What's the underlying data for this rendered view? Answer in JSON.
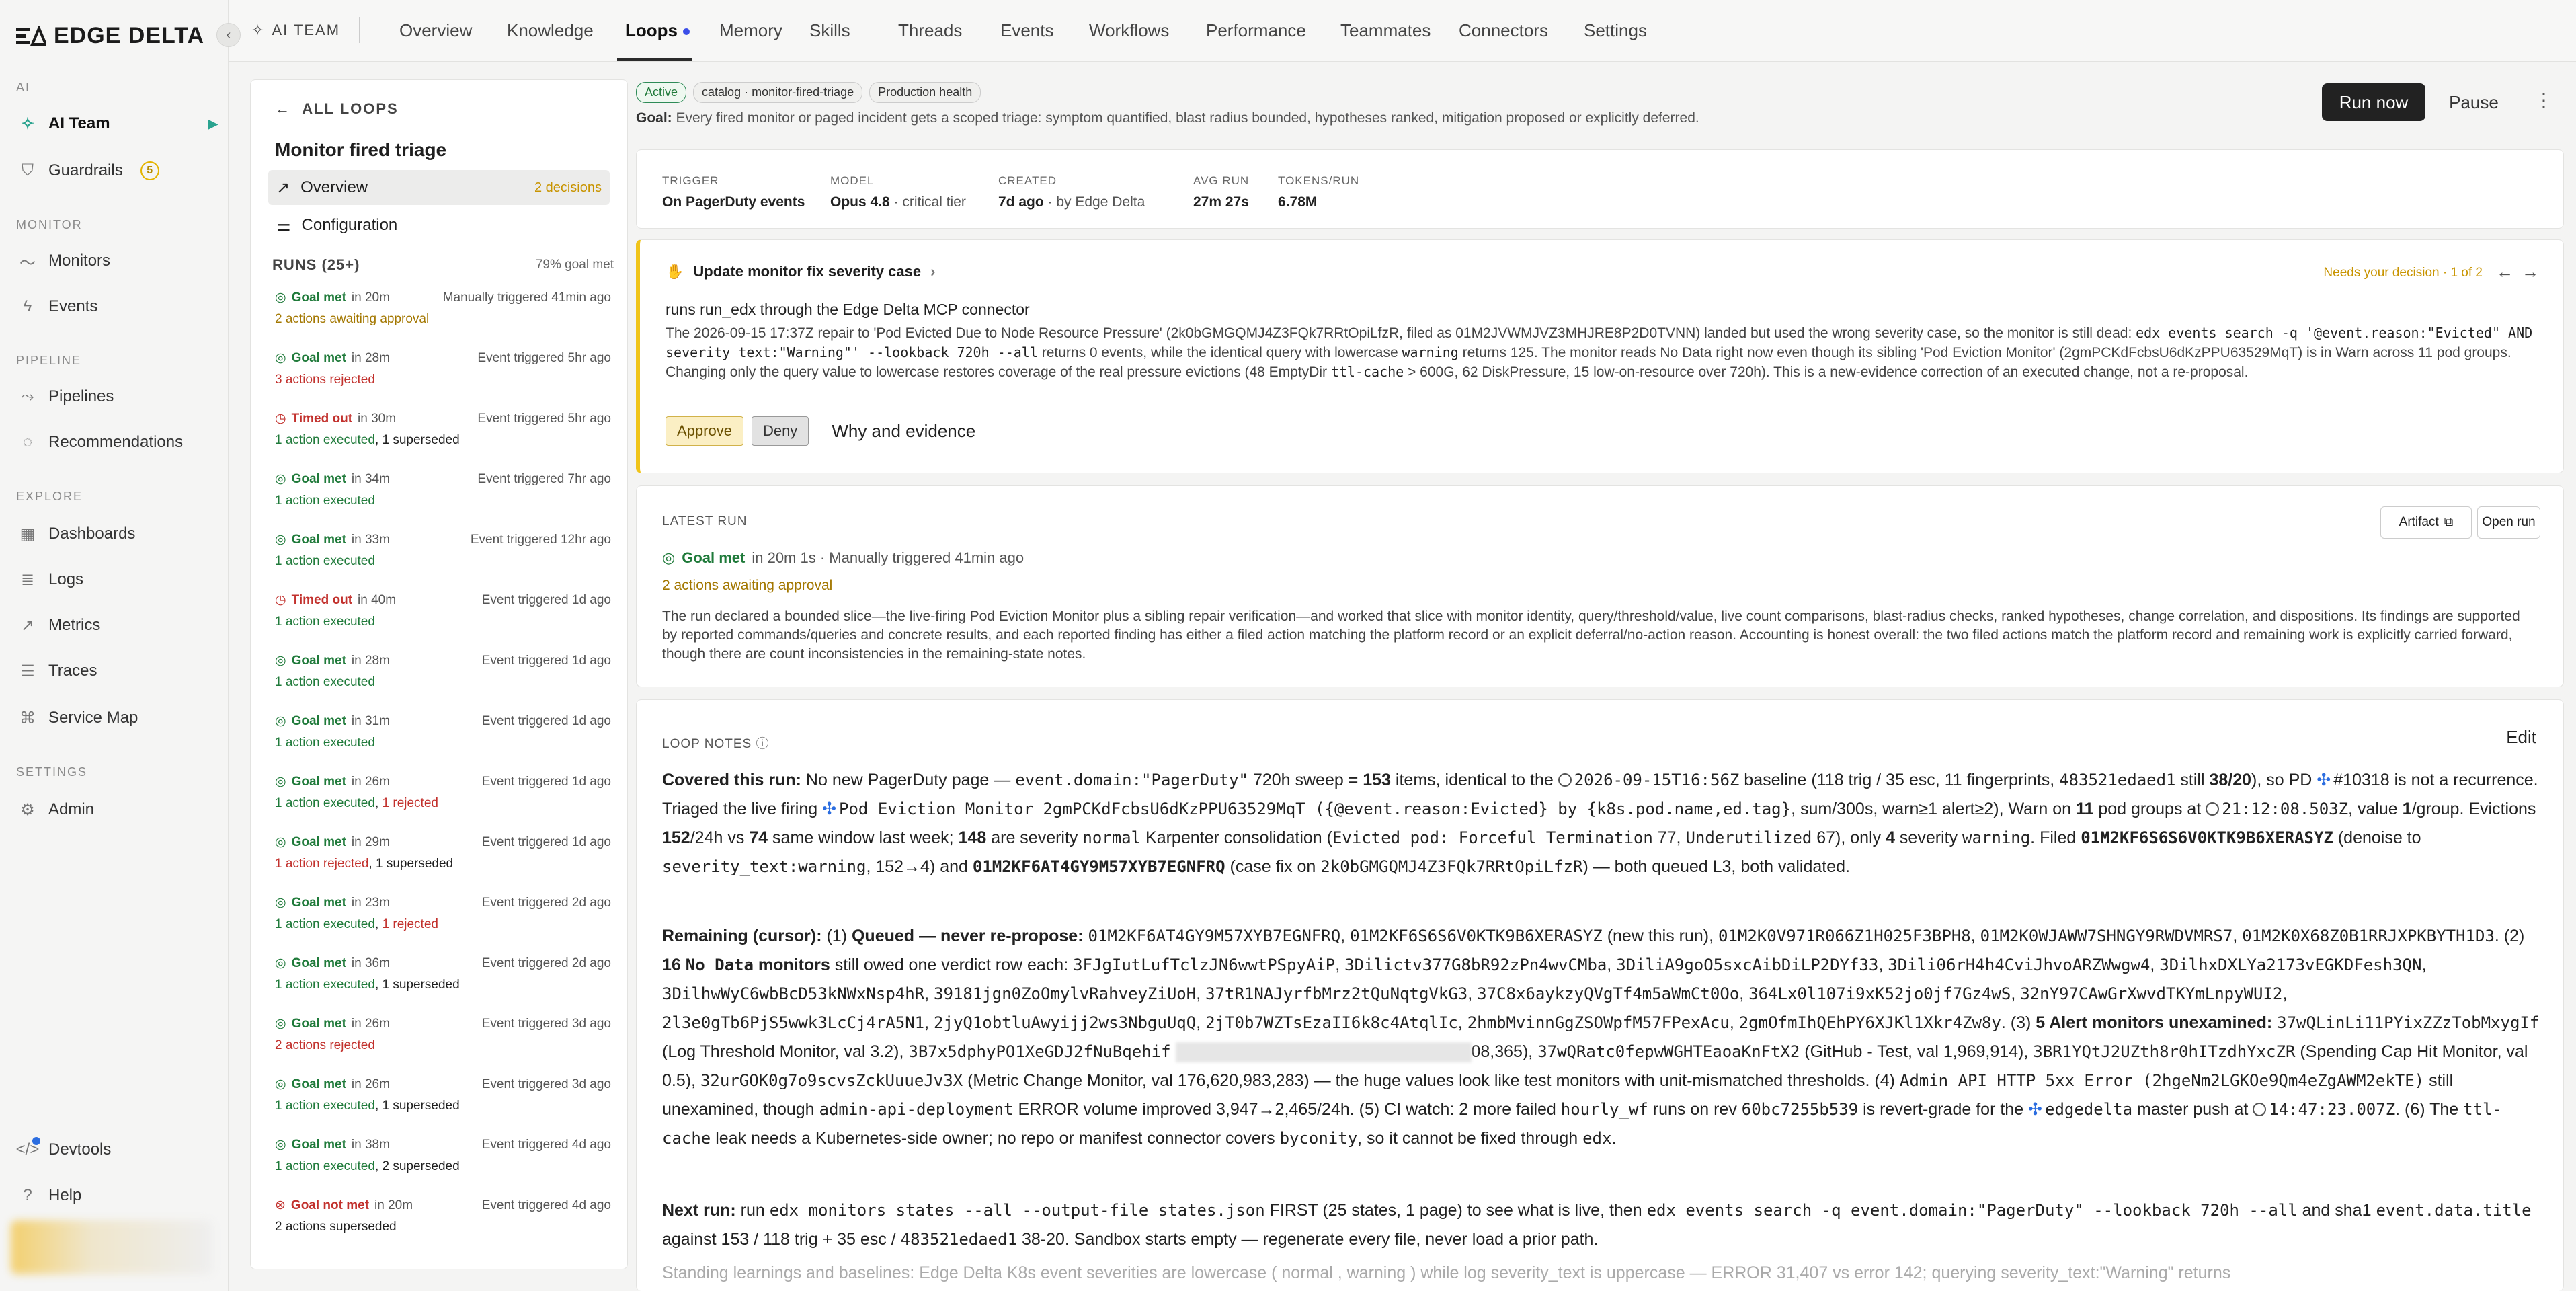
{
  "brand": {
    "name": "EDGE DELTA"
  },
  "leftnav": {
    "sections": {
      "ai": "AI",
      "monitor": "MONITOR",
      "pipeline": "PIPELINE",
      "explore": "EXPLORE",
      "settings": "SETTINGS"
    },
    "items": {
      "ai_team": "AI Team",
      "guardrails": "Guardrails",
      "guardrails_count": "5",
      "monitors": "Monitors",
      "events": "Events",
      "pipelines": "Pipelines",
      "recommendations": "Recommendations",
      "dashboards": "Dashboards",
      "logs": "Logs",
      "metrics": "Metrics",
      "traces": "Traces",
      "service_map": "Service Map",
      "admin": "Admin",
      "devtools": "Devtools",
      "help": "Help"
    }
  },
  "topbar": {
    "crumb": "AI TEAM",
    "tabs": [
      "Overview",
      "Knowledge",
      "Loops",
      "Memory",
      "Skills",
      "Threads",
      "Events",
      "Workflows",
      "Performance",
      "Teammates",
      "Connectors",
      "Settings"
    ],
    "active_tab": "Loops"
  },
  "loop": {
    "back": "ALL LOOPS",
    "title": "Monitor fired triage",
    "overview": "Overview",
    "decisions": "2 decisions",
    "configuration": "Configuration",
    "runs_header": "RUNS (25+)",
    "runs_meta": "79% goal met",
    "runs": [
      {
        "status": "Goal met",
        "dur": "in 20m",
        "trigger": "Manually triggered 41min ago",
        "detail": [
          {
            "t": "2 actions awaiting approval",
            "c": "amber"
          }
        ]
      },
      {
        "status": "Goal met",
        "dur": "in 28m",
        "trigger": "Event triggered 5hr ago",
        "detail": [
          {
            "t": "3 actions rejected",
            "c": "red"
          }
        ]
      },
      {
        "status": "Timed out",
        "dur": "in 30m",
        "trigger": "Event triggered 5hr ago",
        "detail": [
          {
            "t": "1 action executed",
            "c": "green"
          },
          {
            "t": ", ",
            "c": ""
          },
          {
            "t": "1 superseded",
            "c": ""
          }
        ]
      },
      {
        "status": "Goal met",
        "dur": "in 34m",
        "trigger": "Event triggered 7hr ago",
        "detail": [
          {
            "t": "1 action executed",
            "c": "green"
          }
        ]
      },
      {
        "status": "Goal met",
        "dur": "in 33m",
        "trigger": "Event triggered 12hr ago",
        "detail": [
          {
            "t": "1 action executed",
            "c": "green"
          }
        ]
      },
      {
        "status": "Timed out",
        "dur": "in 40m",
        "trigger": "Event triggered 1d ago",
        "detail": [
          {
            "t": "1 action executed",
            "c": "green"
          }
        ]
      },
      {
        "status": "Goal met",
        "dur": "in 28m",
        "trigger": "Event triggered 1d ago",
        "detail": [
          {
            "t": "1 action executed",
            "c": "green"
          }
        ]
      },
      {
        "status": "Goal met",
        "dur": "in 31m",
        "trigger": "Event triggered 1d ago",
        "detail": [
          {
            "t": "1 action executed",
            "c": "green"
          }
        ]
      },
      {
        "status": "Goal met",
        "dur": "in 26m",
        "trigger": "Event triggered 1d ago",
        "detail": [
          {
            "t": "1 action executed",
            "c": "green"
          },
          {
            "t": ", ",
            "c": ""
          },
          {
            "t": "1 rejected",
            "c": "red"
          }
        ]
      },
      {
        "status": "Goal met",
        "dur": "in 29m",
        "trigger": "Event triggered 1d ago",
        "detail": [
          {
            "t": "1 action rejected",
            "c": "red"
          },
          {
            "t": ", ",
            "c": ""
          },
          {
            "t": "1 superseded",
            "c": ""
          }
        ]
      },
      {
        "status": "Goal met",
        "dur": "in 23m",
        "trigger": "Event triggered 2d ago",
        "detail": [
          {
            "t": "1 action executed",
            "c": "green"
          },
          {
            "t": ", ",
            "c": ""
          },
          {
            "t": "1 rejected",
            "c": "red"
          }
        ]
      },
      {
        "status": "Goal met",
        "dur": "in 36m",
        "trigger": "Event triggered 2d ago",
        "detail": [
          {
            "t": "1 action executed",
            "c": "green"
          },
          {
            "t": ", ",
            "c": ""
          },
          {
            "t": "1 superseded",
            "c": ""
          }
        ]
      },
      {
        "status": "Goal met",
        "dur": "in 26m",
        "trigger": "Event triggered 3d ago",
        "detail": [
          {
            "t": "2 actions rejected",
            "c": "red"
          }
        ]
      },
      {
        "status": "Goal met",
        "dur": "in 26m",
        "trigger": "Event triggered 3d ago",
        "detail": [
          {
            "t": "1 action executed",
            "c": "green"
          },
          {
            "t": ", ",
            "c": ""
          },
          {
            "t": "1 superseded",
            "c": ""
          }
        ]
      },
      {
        "status": "Goal met",
        "dur": "in 38m",
        "trigger": "Event triggered 4d ago",
        "detail": [
          {
            "t": "1 action executed",
            "c": "green"
          },
          {
            "t": ", ",
            "c": ""
          },
          {
            "t": "2 superseded",
            "c": ""
          }
        ]
      },
      {
        "status": "Goal not met",
        "dur": "in 20m",
        "trigger": "Event triggered 4d ago",
        "detail": [
          {
            "t": "2 actions superseded",
            "c": ""
          }
        ]
      }
    ]
  },
  "header": {
    "badges": [
      "Active",
      "catalog · monitor-fired-triage",
      "Production health"
    ],
    "goal_label": "Goal:",
    "goal": "Every fired monitor or paged incident gets a scoped triage: symptom quantified, blast radius bounded, hypotheses ranked, mitigation proposed or explicitly deferred.",
    "run_now": "Run now",
    "pause": "Pause"
  },
  "meta": {
    "trigger_k": "TRIGGER",
    "trigger_v": "On PagerDuty events",
    "model_k": "MODEL",
    "model_v": "Opus 4.8",
    "model_extra": " · critical tier",
    "created_k": "CREATED",
    "created_v": "7d ago",
    "created_extra": " · by Edge Delta",
    "avg_k": "AVG RUN",
    "avg_v": "27m 27s",
    "tokens_k": "TOKENS/RUN",
    "tokens_v": "6.78M"
  },
  "decision": {
    "title": "Update monitor fix severity case",
    "needs": "Needs your decision · 1 of 2",
    "sub": "runs run_edx through the Edge Delta MCP connector",
    "body1": "The 2026-09-15 17:37Z repair to 'Pod Evicted Due to Node Resource Pressure' (2k0bGMGQMJ4Z3FQk7RRtOpiLfzR, filed as 01M2JVWMJVZ3MHJRE8P2D0TVNN) landed but used the wrong severity case, so the monitor is still dead: ",
    "code1": "edx events search -q '@event.reason:\"Evicted\" AND severity_text:\"Warning\"' --lookback 720h --all",
    "body2": " returns 0 events, while the identical query with lowercase ",
    "code2": "warning",
    "body3": " returns 125. The monitor reads No Data right now even though its sibling 'Pod Eviction Monitor' (2gmPCKdFcbsU6dKzPPU63529MqT) is in Warn across 11 pod groups. Changing only the query value to lowercase restores coverage of the real pressure evictions (48 EmptyDir ",
    "code3": "ttl-cache",
    "body4": " > 600G, 62 DiskPressure, 15 low-on-resource over 720h). This is a new-evidence correction of an executed change, not a re-proposal.",
    "approve": "Approve",
    "deny": "Deny",
    "why": "Why and evidence"
  },
  "latest": {
    "label": "LATEST RUN",
    "artifact": "Artifact",
    "open_run": "Open run",
    "status": "Goal met",
    "detail": " in 20m 1s · Manually triggered 41min ago",
    "awaiting": "2 actions awaiting approval",
    "body": "The run declared a bounded slice—the live-firing Pod Eviction Monitor plus a sibling repair verification—and worked that slice with monitor identity, query/threshold/value, live count comparisons, blast-radius checks, ranked hypotheses, change correlation, and dispositions. Its findings are supported by reported commands/queries and concrete results, and each reported finding has either a filed action matching the platform record or an explicit deferral/no-action reason. Accounting is honest overall: the two filed actions match the platform record and remaining work is explicitly carried forward, though there are count inconsistencies in the remaining-state notes."
  },
  "notes": {
    "label": "LOOP NOTES",
    "edit": "Edit",
    "p1": [
      [
        "b",
        "Covered this run:"
      ],
      [
        "t",
        " No new PagerDuty page — "
      ],
      [
        "m",
        "event.domain:\"PagerDuty\""
      ],
      [
        "t",
        " 720h sweep = "
      ],
      [
        "b",
        "153"
      ],
      [
        "t",
        " items, identical to the "
      ],
      [
        "clock",
        ""
      ],
      [
        "m",
        "2026-09-15T16:56Z"
      ],
      [
        "t",
        " baseline (118 trig / 35 esc, 11 fingerprints, "
      ],
      [
        "m",
        "483521edaed1"
      ],
      [
        "t",
        " still "
      ],
      [
        "b",
        "38/20"
      ],
      [
        "t",
        "), so PD "
      ],
      [
        "fan",
        ""
      ],
      [
        "t",
        "#10318 is not a recurrence. Triaged the live firing "
      ],
      [
        "fan",
        ""
      ],
      [
        "m",
        "Pod Eviction Monitor 2gmPCKdFcbsU6dKzPPU63529MqT ({@event.reason:Evicted} by {k8s.pod.name,ed.tag}"
      ],
      [
        "t",
        ", sum/300s, warn≥1 alert≥2), Warn on "
      ],
      [
        "b",
        "11"
      ],
      [
        "t",
        " pod groups at "
      ],
      [
        "clock",
        ""
      ],
      [
        "m",
        "21:12:08.503Z"
      ],
      [
        "t",
        ", value "
      ],
      [
        "b",
        "1"
      ],
      [
        "t",
        "/group. Evictions "
      ],
      [
        "b",
        "152"
      ],
      [
        "t",
        "/24h vs "
      ],
      [
        "b",
        "74"
      ],
      [
        "t",
        " same window last week; "
      ],
      [
        "b",
        "148"
      ],
      [
        "t",
        " are severity "
      ],
      [
        "m",
        "normal"
      ],
      [
        "t",
        " Karpenter consolidation ("
      ],
      [
        "m",
        "Evicted pod: Forceful Termination"
      ],
      [
        "t",
        " 77, "
      ],
      [
        "m",
        "Underutilized"
      ],
      [
        "t",
        " 67), only "
      ],
      [
        "b",
        "4"
      ],
      [
        "t",
        " severity "
      ],
      [
        "m",
        "warning"
      ],
      [
        "t",
        ". Filed "
      ],
      [
        "mb",
        "01M2KF6S6S6V0KTK9B6XERASYZ"
      ],
      [
        "t",
        " (denoise to "
      ],
      [
        "m",
        "severity_text:warning"
      ],
      [
        "t",
        ", 152→4) and "
      ],
      [
        "mb",
        "01M2KF6AT4GY9M57XYB7EGNFRQ"
      ],
      [
        "t",
        " (case fix on "
      ],
      [
        "m",
        "2k0bGMGQMJ4Z3FQk7RRtOpiLfzR"
      ],
      [
        "t",
        ") — both queued L3, both validated."
      ]
    ],
    "p2": [
      [
        "b",
        "Remaining (cursor):"
      ],
      [
        "t",
        " (1) "
      ],
      [
        "b",
        "Queued — never re-propose:"
      ],
      [
        "t",
        " "
      ],
      [
        "m",
        "01M2KF6AT4GY9M57XYB7EGNFRQ"
      ],
      [
        "t",
        ", "
      ],
      [
        "m",
        "01M2KF6S6S6V0KTK9B6XERASYZ"
      ],
      [
        "t",
        " (new this run), "
      ],
      [
        "m",
        "01M2K0V971R066Z1H025F3BPH8"
      ],
      [
        "t",
        ", "
      ],
      [
        "m",
        "01M2K0WJAWW7SHNGY9RWDVMRS7"
      ],
      [
        "t",
        ", "
      ],
      [
        "m",
        "01M2K0X68Z0B1RRJXPKBYTH1D3"
      ],
      [
        "t",
        ". (2) "
      ],
      [
        "b",
        "16 "
      ],
      [
        "mb",
        "No Data"
      ],
      [
        "b",
        " monitors"
      ],
      [
        "t",
        " still owed one verdict row each: "
      ],
      [
        "m",
        "3FJgIutLufTclzJN6wwtPSpyAiP"
      ],
      [
        "t",
        ", "
      ],
      [
        "m",
        "3Dilictv377G8bR92zPn4wvCMba"
      ],
      [
        "t",
        ", "
      ],
      [
        "m",
        "3DiliA9goO5sxcAibDiLP2DYf33"
      ],
      [
        "t",
        ", "
      ],
      [
        "m",
        "3Dili06rH4h4CviJhvoARZWwgw4"
      ],
      [
        "t",
        ", "
      ],
      [
        "m",
        "3DilhxDXLYa2173vEGKDFesh3QN"
      ],
      [
        "t",
        ", "
      ],
      [
        "m",
        "3DilhwWyC6wbBcD53kNWxNsp4hR"
      ],
      [
        "t",
        ", "
      ],
      [
        "m",
        "39181jgn0ZoOmylvRahveyZiUoH"
      ],
      [
        "t",
        ", "
      ],
      [
        "m",
        "37tR1NAJyrfbMrz2tQuNqtgVkG3"
      ],
      [
        "t",
        ", "
      ],
      [
        "m",
        "37C8x6aykzyQVgTf4m5aWmCt0Oo"
      ],
      [
        "t",
        ", "
      ],
      [
        "m",
        "364Lx0l107i9xK52jo0jf7Gz4wS"
      ],
      [
        "t",
        ", "
      ],
      [
        "m",
        "32nY97CAwGrXwvdTKYmLnpyWUI2"
      ],
      [
        "t",
        ", "
      ],
      [
        "m",
        "2l3e0gTb6PjS5wwk3LcCj4rA5N1"
      ],
      [
        "t",
        ", "
      ],
      [
        "m",
        "2jyQ1obtluAwyijj2ws3NbguUqQ"
      ],
      [
        "t",
        ", "
      ],
      [
        "m",
        "2jT0b7WZTsEzaII6k8c4AtqlIc"
      ],
      [
        "t",
        ", "
      ],
      [
        "m",
        "2hmbMvinnGgZSOWpfM57FPexAcu"
      ],
      [
        "t",
        ", "
      ],
      [
        "m",
        "2gmOfmIhQEhPY6XJKl1Xkr4Zw8y"
      ],
      [
        "t",
        ". (3) "
      ],
      [
        "b",
        "5 Alert monitors unexamined:"
      ],
      [
        "t",
        " "
      ],
      [
        "m",
        "37wQLinLi11PYixZZzTobMxygIf"
      ],
      [
        "t",
        " (Log Threshold Monitor, val 3.2), "
      ],
      [
        "m",
        "3B7x5dphyPO1XeGDJ2fNuBqehif"
      ],
      [
        "t",
        " "
      ],
      [
        "redact",
        ""
      ],
      [
        "t",
        "08,365), "
      ],
      [
        "m",
        "37wQRatc0fepwWGHTEaoaKnFtX2"
      ],
      [
        "t",
        " (GitHub - Test, val 1,969,914), "
      ],
      [
        "m",
        "3BR1YQtJ2UZth8r0hITzdhYxcZR"
      ],
      [
        "t",
        " (Spending Cap Hit Monitor, val 0.5), "
      ],
      [
        "m",
        "32urGOK0g7o9scvsZckUuueJv3X"
      ],
      [
        "t",
        " (Metric Change Monitor, val 176,620,983,283) — the huge values look like test monitors with unit-mismatched thresholds. (4) "
      ],
      [
        "m",
        "Admin API HTTP 5xx Error (2hgeNm2LGKOe9Qm4eZgAWM2ekTE)"
      ],
      [
        "t",
        " still unexamined, though "
      ],
      [
        "m",
        "admin-api-deployment"
      ],
      [
        "t",
        " ERROR volume improved 3,947→2,465/24h. (5) CI watch: 2 more failed "
      ],
      [
        "m",
        "hourly_wf"
      ],
      [
        "t",
        " runs on rev "
      ],
      [
        "m",
        "60bc7255b539"
      ],
      [
        "t",
        " is revert-grade for the "
      ],
      [
        "fan",
        ""
      ],
      [
        "m",
        "edgedelta"
      ],
      [
        "t",
        " master push at "
      ],
      [
        "clock",
        ""
      ],
      [
        "m",
        "14:47:23.007Z"
      ],
      [
        "t",
        ". (6) The "
      ],
      [
        "m",
        "ttl-cache"
      ],
      [
        "t",
        " leak needs a Kubernetes-side owner; no repo or manifest connector covers "
      ],
      [
        "m",
        "byconity"
      ],
      [
        "t",
        ", so it cannot be fixed through "
      ],
      [
        "m",
        "edx"
      ],
      [
        "t",
        "."
      ]
    ],
    "p3": [
      [
        "b",
        "Next run:"
      ],
      [
        "t",
        " run "
      ],
      [
        "m",
        "edx monitors states --all --output-file states.json"
      ],
      [
        "t",
        " FIRST (25 states, 1 page) to see what is live, then "
      ],
      [
        "m",
        "edx events search -q event.domain:\"PagerDuty\" --lookback 720h --all"
      ],
      [
        "t",
        " and sha1 "
      ],
      [
        "m",
        "event.data.title"
      ],
      [
        "t",
        " against 153 / 118 trig + 35 esc / "
      ],
      [
        "m",
        "483521edaed1"
      ],
      [
        "t",
        " 38-20. Sandbox starts empty — regenerate every file, never load a prior path."
      ]
    ],
    "p4": "Standing learnings and baselines: Edge Delta K8s event severities are lowercase ( normal , warning ) while log severity_text is uppercase — ERROR 31,407 vs error 142; querying severity_text:\"Warning\" returns"
  }
}
